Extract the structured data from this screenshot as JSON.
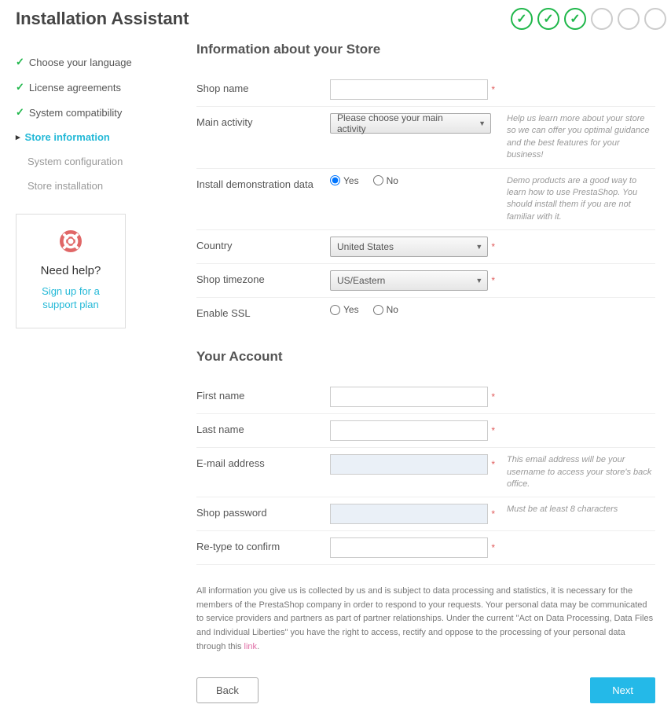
{
  "header": {
    "title": "Installation Assistant"
  },
  "sidebar": {
    "items": [
      {
        "label": "Choose your language",
        "state": "done"
      },
      {
        "label": "License agreements",
        "state": "done"
      },
      {
        "label": "System compatibility",
        "state": "done"
      },
      {
        "label": "Store information",
        "state": "current"
      },
      {
        "label": "System configuration",
        "state": "future"
      },
      {
        "label": "Store installation",
        "state": "future"
      }
    ]
  },
  "help": {
    "title": "Need help?",
    "link": "Sign up for a support plan"
  },
  "store_section": {
    "heading": "Information about your Store",
    "shop_name_label": "Shop name",
    "shop_name_value": "",
    "activity_label": "Main activity",
    "activity_value": "Please choose your main activity",
    "activity_hint": "Help us learn more about your store so we can offer you optimal guidance and the best features for your business!",
    "demo_label": "Install demonstration data",
    "demo_yes": "Yes",
    "demo_no": "No",
    "demo_hint": "Demo products are a good way to learn how to use PrestaShop. You should install them if you are not familiar with it.",
    "country_label": "Country",
    "country_value": "United States",
    "timezone_label": "Shop timezone",
    "timezone_value": "US/Eastern",
    "ssl_label": "Enable SSL",
    "ssl_yes": "Yes",
    "ssl_no": "No"
  },
  "account_section": {
    "heading": "Your Account",
    "firstname_label": "First name",
    "firstname_value": "",
    "lastname_label": "Last name",
    "lastname_value": "",
    "email_label": "E-mail address",
    "email_value": "",
    "email_hint": "This email address will be your username to access your store's back office.",
    "password_label": "Shop password",
    "password_value": "",
    "password_hint": "Must be at least 8 characters",
    "confirm_label": "Re-type to confirm",
    "confirm_value": ""
  },
  "legal": {
    "text_before": "All information you give us is collected by us and is subject to data processing and statistics, it is necessary for the members of the PrestaShop company in order to respond to your requests. Your personal data may be communicated to service providers and partners as part of partner relationships. Under the current \"Act on Data Processing, Data Files and Individual Liberties\" you have the right to access, rectify and oppose to the processing of your personal data through this ",
    "link_text": "link",
    "text_after": "."
  },
  "actions": {
    "back": "Back",
    "next": "Next"
  }
}
